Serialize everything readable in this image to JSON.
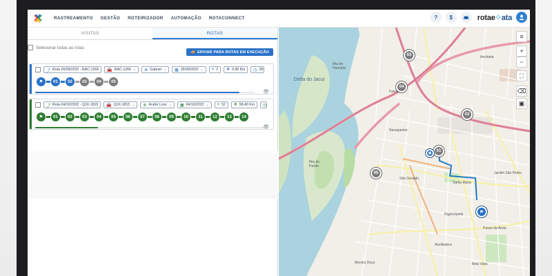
{
  "nav": {
    "items": [
      "RASTREAMENTO",
      "GESTÃO",
      "ROTEIRIZADOR",
      "AUTOMAÇÃO",
      "ROTACONNECT"
    ]
  },
  "top_right": {
    "help_icon": "?",
    "money_icon": "$",
    "brand_part1": "rotae",
    "brand_part2": "ata"
  },
  "tabs": [
    {
      "label": "VISITAS",
      "active": false
    },
    {
      "label": "ROTAS",
      "active": true
    }
  ],
  "select_all_label": "Selecionar todas as rotas",
  "send_button_label": "ENVIAR PARA ROTAS EM EXECUÇÃO",
  "routes": [
    {
      "accent": "#2a72c8",
      "name": "Rota 26/09/2022 - RAC-1266",
      "vehicle": "RAC-1266",
      "driver": "Gabriel",
      "date": "26/09/2022",
      "stops_count": "2",
      "distance": "0.98 Km",
      "time": "00",
      "stops": [
        "01",
        "02",
        "03",
        "04",
        "05"
      ],
      "completed_stops": 2,
      "progress": 0.93
    },
    {
      "accent": "#2e7d32",
      "name": "Rota 04/10/2022 - QJX-1815",
      "vehicle": "QJX-1815",
      "driver": "André Loss",
      "date": "04/10/2022",
      "stops_count": "52",
      "distance": "58.40 Km",
      "time": "",
      "stops": [
        "01",
        "02",
        "03",
        "04",
        "05",
        "06",
        "07",
        "08",
        "09",
        "10",
        "11",
        "12",
        "13",
        "14"
      ],
      "completed_stops": 14,
      "progress": 0.27
    }
  ],
  "map": {
    "labels": {
      "ilha_humaita": "Ilha do Humaitá",
      "delta": "Delta do Jacuí",
      "ilha_pavao": "Ilha do Pavão",
      "navegantes": "Navegantes",
      "santa_maria": "Santa Maria",
      "higienopolis": "Higienópolis",
      "passo_areia": "Passo da Areia",
      "auxiliadora": "Auxiliadora",
      "menino_deus": "Menino Deus",
      "bela_vista": "Bela Vista",
      "sao_geraldo": "São Geraldo",
      "anchieta": "Anchieta",
      "bom_jesus": "Jardim São Pedro",
      "farrapos": "Farrapos"
    },
    "pins": [
      {
        "label": "03",
        "color": "gray"
      },
      {
        "label": "04",
        "color": "gray"
      },
      {
        "label": "02",
        "color": "gray"
      },
      {
        "label": "01",
        "color": "gray"
      },
      {
        "label": "05",
        "color": "gray"
      }
    ],
    "controls": [
      "layers-icon",
      "zoom-in-icon",
      "zoom-out-icon",
      "fullscreen-icon",
      "eraser-icon",
      "save-icon"
    ]
  }
}
